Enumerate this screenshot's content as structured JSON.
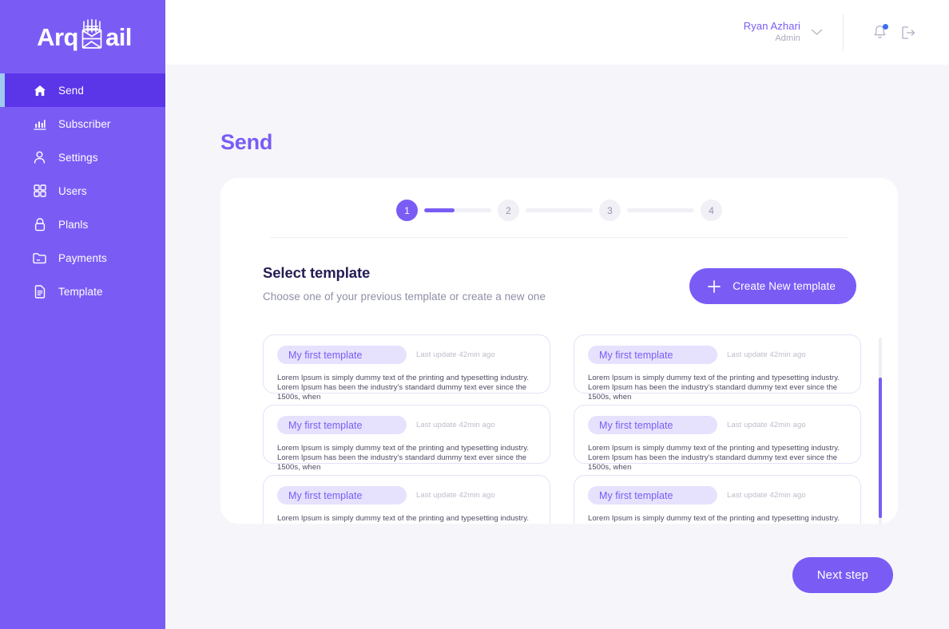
{
  "brand": {
    "name_part1": "Arq",
    "name_part2": "ail",
    "envelope_icon": "envelope-icon",
    "accent": "#7a5cf5"
  },
  "sidebar": {
    "items": [
      {
        "label": "Send",
        "icon": "home-icon",
        "active": true
      },
      {
        "label": "Subscriber",
        "icon": "bar-chart-icon",
        "active": false
      },
      {
        "label": "Settings",
        "icon": "person-icon",
        "active": false
      },
      {
        "label": "Users",
        "icon": "grid-icon",
        "active": false
      },
      {
        "label": "Planls",
        "icon": "lock-icon",
        "active": false
      },
      {
        "label": "Payments",
        "icon": "folder-icon",
        "active": false
      },
      {
        "label": "Template",
        "icon": "document-icon",
        "active": false
      }
    ]
  },
  "topbar": {
    "user_name": "Ryan Azhari",
    "user_role": "Admin",
    "chevron_icon": "chevron-down-icon",
    "notification_icon": "bell-icon",
    "notification_dot_color": "#3d6df0",
    "logout_icon": "logout-icon"
  },
  "page": {
    "title": "Send"
  },
  "stepper": {
    "steps": [
      "1",
      "2",
      "3",
      "4"
    ],
    "active_index": 0,
    "progress_percent": 45
  },
  "select_template": {
    "title": "Select template",
    "subtitle": "Choose one of your previous template or create a new one",
    "create_button": {
      "label": "Create New template",
      "icon": "plus-icon"
    }
  },
  "templates": [
    {
      "name": "My first template",
      "meta": "Last update 42min ago",
      "body": "Lorem Ipsum is simply dummy text of the printing and typesetting industry. Lorem Ipsum has been the industry's standard dummy text ever since the 1500s, when"
    },
    {
      "name": "My first template",
      "meta": "Last update 42min ago",
      "body": "Lorem Ipsum is simply dummy text of the printing and typesetting industry. Lorem Ipsum has been the industry's standard dummy text ever since the 1500s, when"
    },
    {
      "name": "My first template",
      "meta": "Last update 42min ago",
      "body": "Lorem Ipsum is simply dummy text of the printing and typesetting industry. Lorem Ipsum has been the industry's standard dummy text ever since the 1500s, when"
    },
    {
      "name": "My first template",
      "meta": "Last update 42min ago",
      "body": "Lorem Ipsum is simply dummy text of the printing and typesetting industry. Lorem Ipsum has been the industry's standard dummy text ever since the 1500s, when"
    },
    {
      "name": "My first template",
      "meta": "Last update 42min ago",
      "body": "Lorem Ipsum is simply dummy text of the printing and typesetting industry. Lorem Ipsum"
    },
    {
      "name": "My first template",
      "meta": "Last update 42min ago",
      "body": "Lorem Ipsum is simply dummy text of the printing and typesetting industry. Lorem Ipsum"
    }
  ],
  "footer": {
    "next_button_label": "Next step"
  }
}
